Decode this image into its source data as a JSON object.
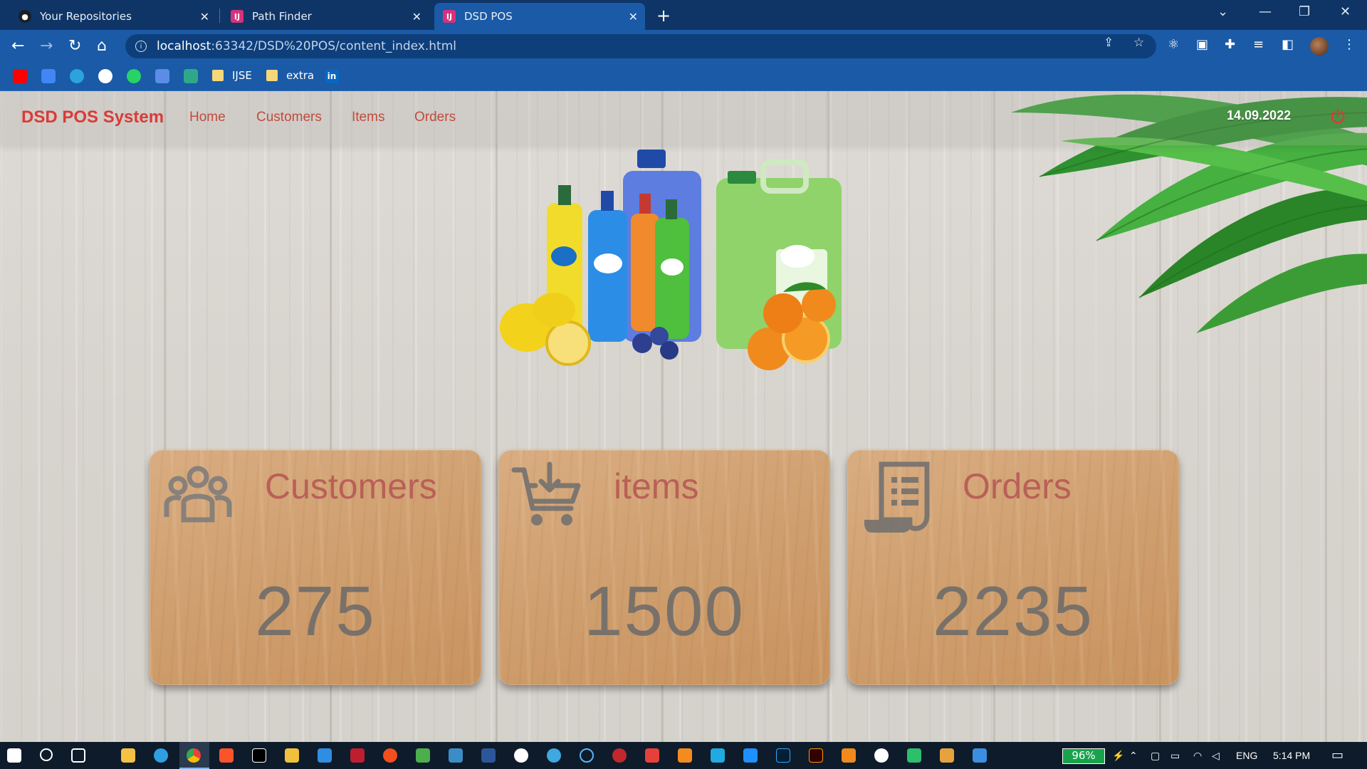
{
  "browser": {
    "tabs": [
      {
        "title": "Your Repositories",
        "active": false
      },
      {
        "title": "Path Finder",
        "active": false
      },
      {
        "title": "DSD POS",
        "active": true
      }
    ],
    "url_host": "localhost",
    "url_path": ":63342/DSD%20POS/content_index.html",
    "bookmarks": [
      {
        "label": "IJSE"
      },
      {
        "label": "extra"
      }
    ]
  },
  "nav": {
    "brand": "DSD POS System",
    "links": [
      "Home",
      "Customers",
      "Items",
      "Orders"
    ],
    "date": "14.09.2022"
  },
  "cards": [
    {
      "title": "Customers",
      "count": "275",
      "icon": "users-icon"
    },
    {
      "title": "items",
      "count": "1500",
      "icon": "cart-download-icon"
    },
    {
      "title": "Orders",
      "count": "2235",
      "icon": "receipt-icon"
    }
  ],
  "taskbar": {
    "battery": "96%",
    "language": "ENG",
    "time": "5:14 PM"
  },
  "colors": {
    "brand": "#d93b37",
    "nav_link": "#c14b3d",
    "card_title": "#b85a56",
    "chrome": "#1a5aa6"
  }
}
